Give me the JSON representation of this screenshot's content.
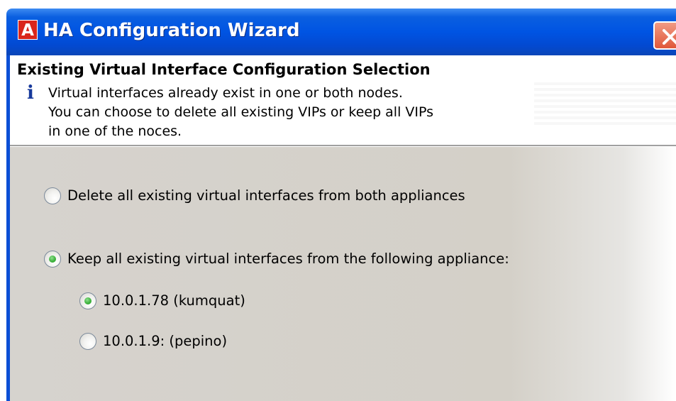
{
  "window": {
    "title": "HA Configuration Wizard",
    "app_icon_letter": "A"
  },
  "header": {
    "title": "Existing Virtual Interface Configuration Selection",
    "info_icon_glyph": "i",
    "description_lines": [
      "Virtual interfaces already exist in one or both nodes.",
      "You can choose to delete all existing VIPs or keep all VIPs",
      "in one of the noces."
    ]
  },
  "options": [
    {
      "label": "Delete all existing virtual interfaces from both appliances",
      "checked": false
    },
    {
      "label": "Keep all existing virtual interfaces from the following appliance:",
      "checked": true
    }
  ],
  "appliances": [
    {
      "label": "10.0.1.78 (kumquat)",
      "checked": true
    },
    {
      "label": "10.0.1.9: (pepino)",
      "checked": false
    }
  ],
  "colors": {
    "titlebar": "#0054e3",
    "body_background": "#d4d0c8",
    "radio_selected": "#3fb23f",
    "app_icon": "#d9261c"
  }
}
